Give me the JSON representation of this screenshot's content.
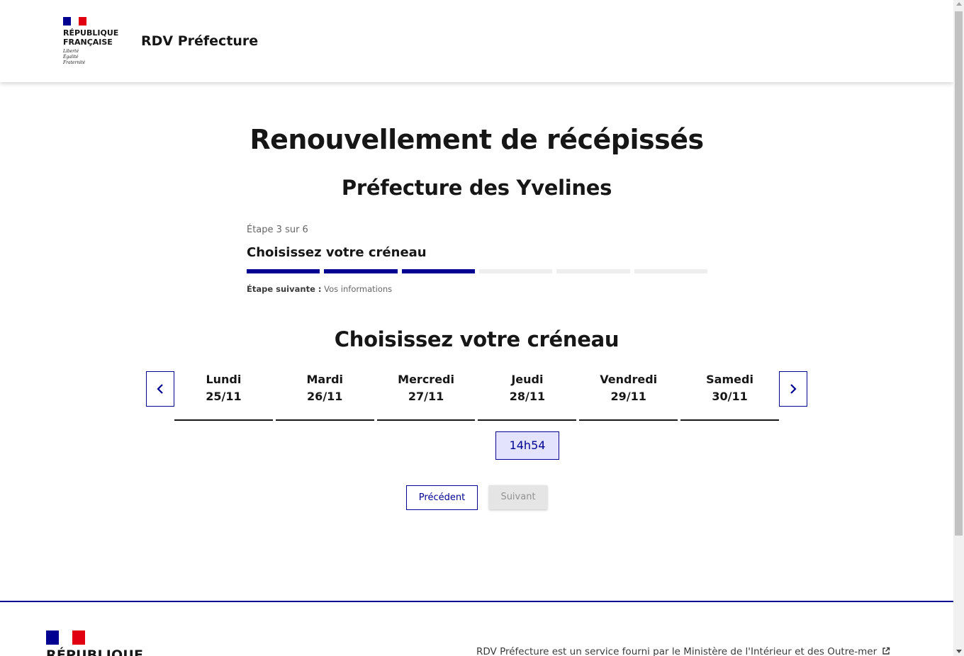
{
  "header": {
    "logo_line1": "RÉPUBLIQUE",
    "logo_line2": "FRANÇAISE",
    "motto1": "Liberté",
    "motto2": "Égalité",
    "motto3": "Fraternité",
    "service_title": "RDV Préfecture"
  },
  "main": {
    "title": "Renouvellement de récépissés",
    "subtitle": "Préfecture des Yvelines",
    "stepper": {
      "state": "Étape 3 sur 6",
      "title": "Choisissez votre créneau",
      "total_steps": 6,
      "current_step": 3,
      "next_label": "Étape suivante :",
      "next_value": "Vos informations"
    },
    "section_title": "Choisissez votre créneau",
    "calendar": {
      "prev_icon": "chevron-left-icon",
      "next_icon": "chevron-right-icon",
      "days": [
        {
          "name": "Lundi",
          "date": "25/11"
        },
        {
          "name": "Mardi",
          "date": "26/11"
        },
        {
          "name": "Mercredi",
          "date": "27/11"
        },
        {
          "name": "Jeudi",
          "date": "28/11"
        },
        {
          "name": "Vendredi",
          "date": "29/11"
        },
        {
          "name": "Samedi",
          "date": "30/11"
        }
      ],
      "slot": {
        "day": "Jeudi",
        "time": "14h54"
      }
    },
    "buttons": {
      "previous": "Précédent",
      "next": "Suivant"
    }
  },
  "footer": {
    "logo_line1": "RÉPUBLIQUE",
    "description": "RDV Préfecture est un service fourni par le Ministère de l'Intérieur et des Outre-mer",
    "external_icon": "external-link-icon"
  },
  "colors": {
    "primary": "#000091",
    "flag_blue": "#000091",
    "flag_red": "#e1000f",
    "slot_bg": "#e3e3fd",
    "disabled_bg": "#e5e5e5"
  }
}
